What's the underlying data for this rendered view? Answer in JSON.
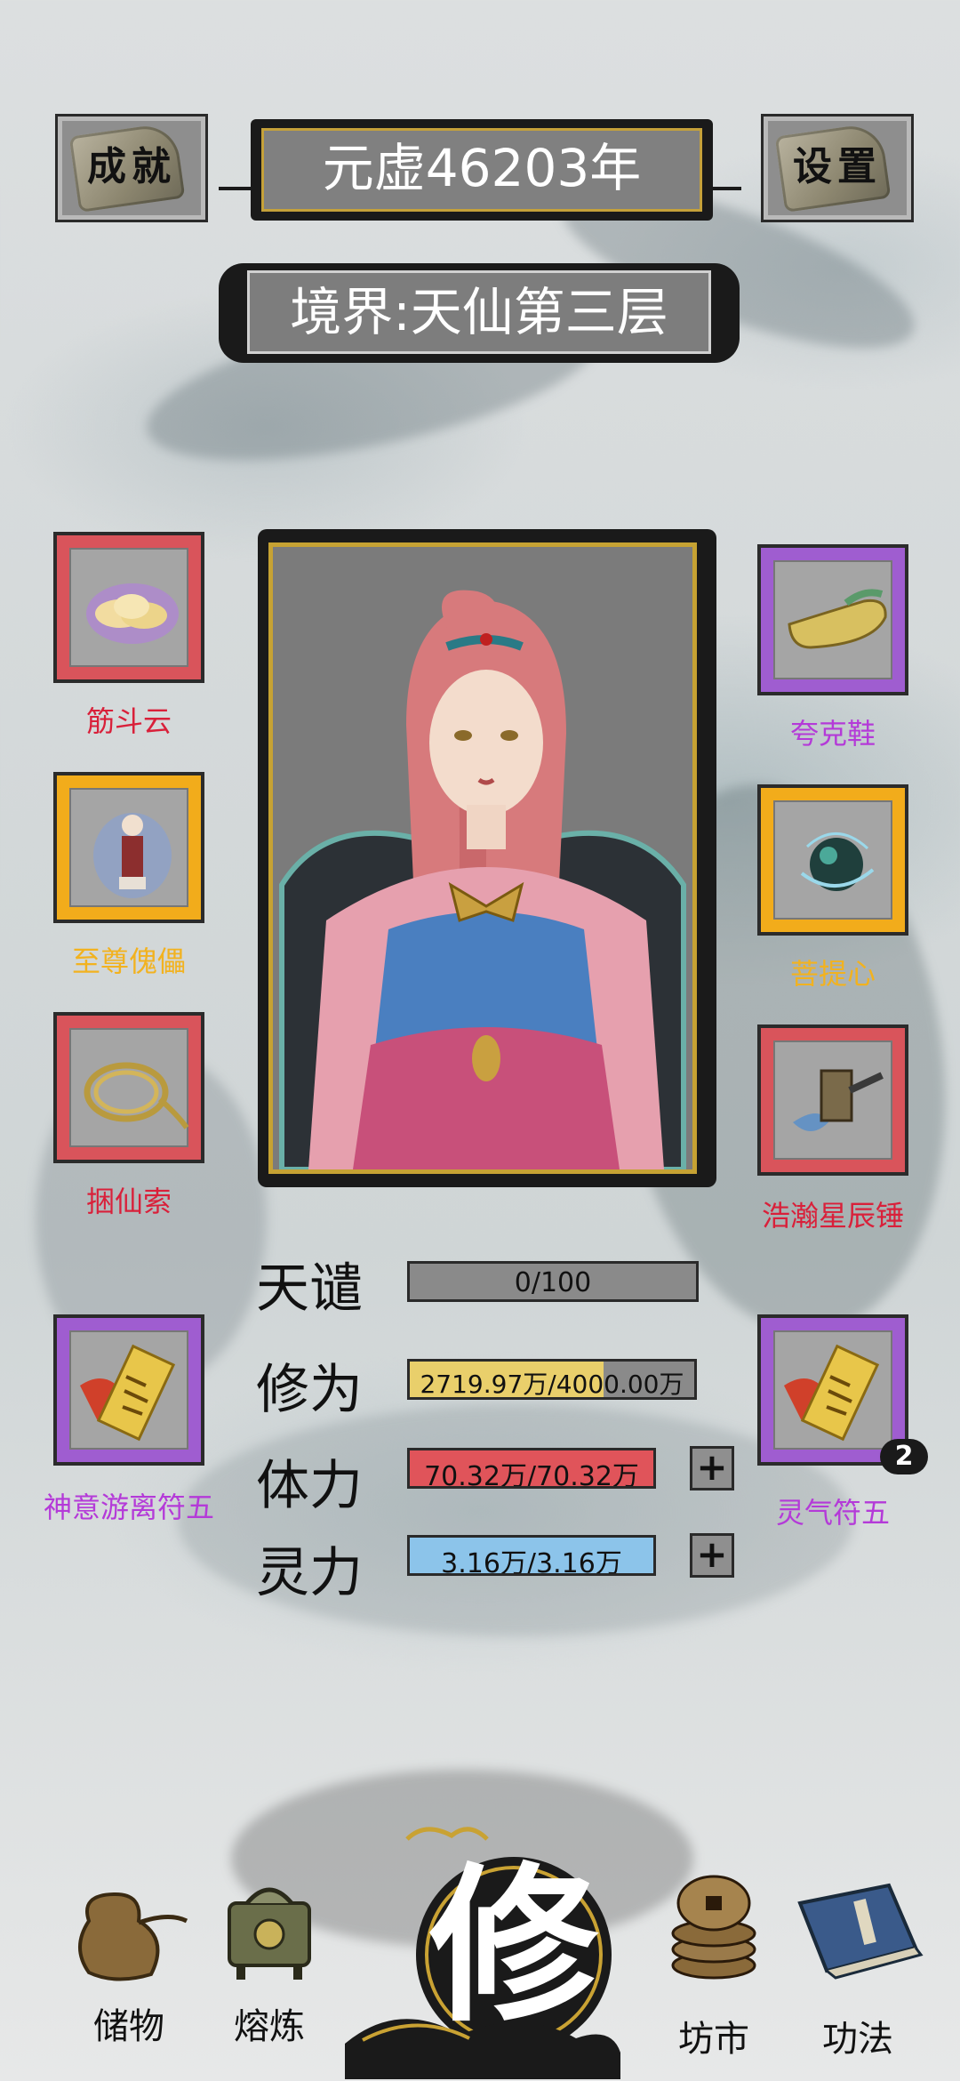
{
  "header": {
    "achievements_label": "成就",
    "year_text": "元虚46203年",
    "settings_label": "设置",
    "realm_text": "境界:天仙第三层"
  },
  "equipment_left": [
    {
      "name": "筋斗云",
      "rarity": "red"
    },
    {
      "name": "至尊傀儡",
      "rarity": "gold"
    },
    {
      "name": "捆仙索",
      "rarity": "red"
    },
    {
      "name": "神意游离符五",
      "rarity": "purple"
    }
  ],
  "equipment_right": [
    {
      "name": "夸克鞋",
      "rarity": "purple"
    },
    {
      "name": "菩提心",
      "rarity": "gold"
    },
    {
      "name": "浩瀚星辰锤",
      "rarity": "red"
    },
    {
      "name": "灵气符五",
      "rarity": "purple",
      "count": "2"
    }
  ],
  "stats": {
    "tianqian": {
      "label": "天谴",
      "value": "0/100",
      "fraction": 0.0
    },
    "xiuwei": {
      "label": "修为",
      "value": "2719.97万/4000.00万",
      "fraction": 0.68
    },
    "tili": {
      "label": "体力",
      "value": "70.32万/70.32万",
      "fraction": 1.0
    },
    "lingli": {
      "label": "灵力",
      "value": "3.16万/3.16万",
      "fraction": 1.0
    },
    "plus_symbol": "+"
  },
  "colors": {
    "rarity_red": "#d9545b",
    "rarity_purple": "#9f5dd0",
    "rarity_gold": "#f2ac1b",
    "xiuwei_fill": "#e9cf6b",
    "tili_fill": "#e0545a",
    "lingli_fill": "#8cc4ea"
  },
  "nav": {
    "storage": "储物",
    "smelting": "熔炼",
    "cultivate": "修",
    "market": "坊市",
    "techniques": "功法"
  }
}
